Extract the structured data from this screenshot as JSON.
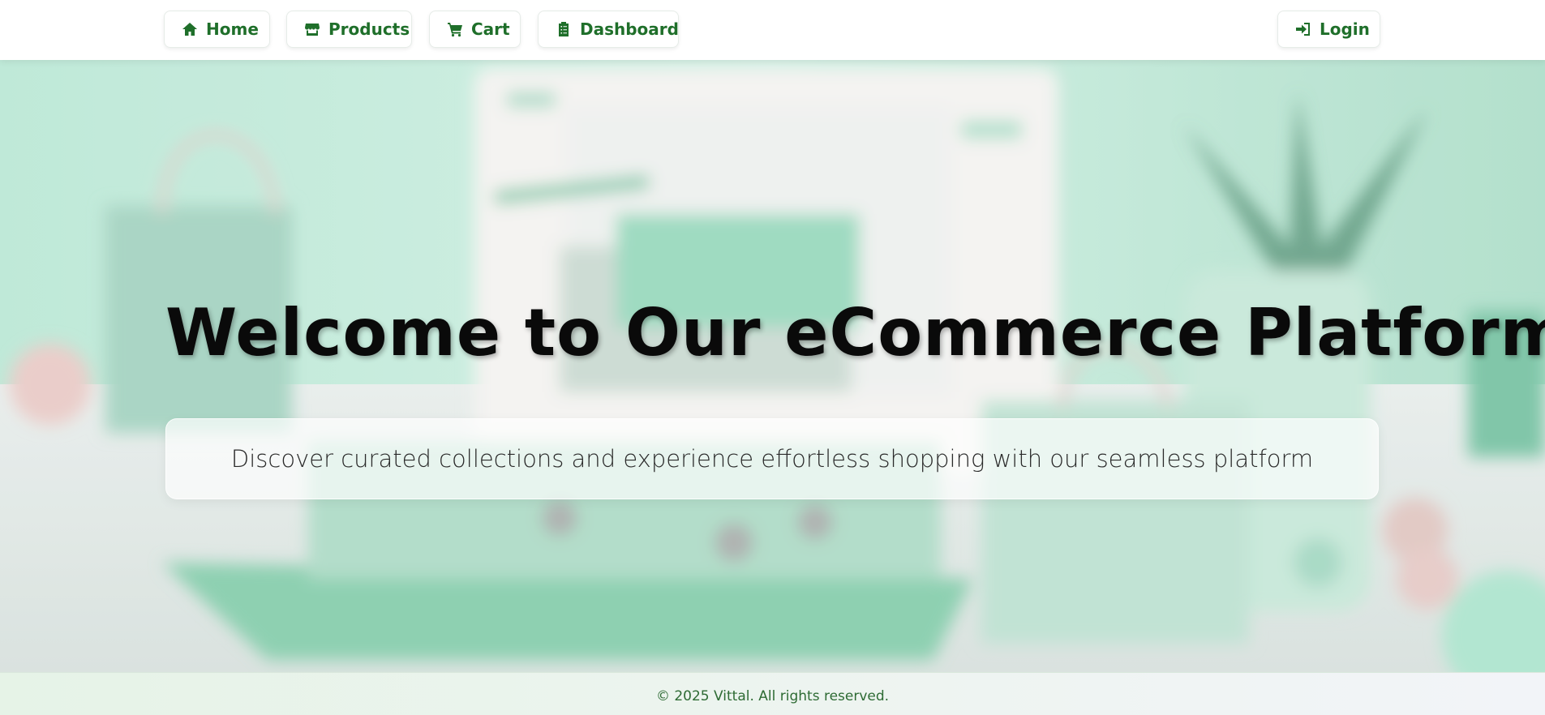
{
  "nav": {
    "items": [
      {
        "label": "Home",
        "icon": "home-icon"
      },
      {
        "label": "Products",
        "icon": "store-icon"
      },
      {
        "label": "Cart",
        "icon": "cart-icon"
      },
      {
        "label": "Dashboard",
        "icon": "clipboard-icon"
      }
    ],
    "login": {
      "label": "Login",
      "icon": "sign-in-icon"
    }
  },
  "hero": {
    "title": "Welcome to Our eCommerce Platform",
    "subtitle": "Discover curated collections and experience effortless shopping with our seamless platform",
    "background": "blurred-ecommerce-scene-image"
  },
  "footer": {
    "text": "© 2025 Vittal. All rights reserved."
  },
  "colors": {
    "accent": "#1f6f2a",
    "hero_tint": "#bfe9d7",
    "footer_bg": "#e6f3e7",
    "footer_text": "#2e6b34"
  }
}
